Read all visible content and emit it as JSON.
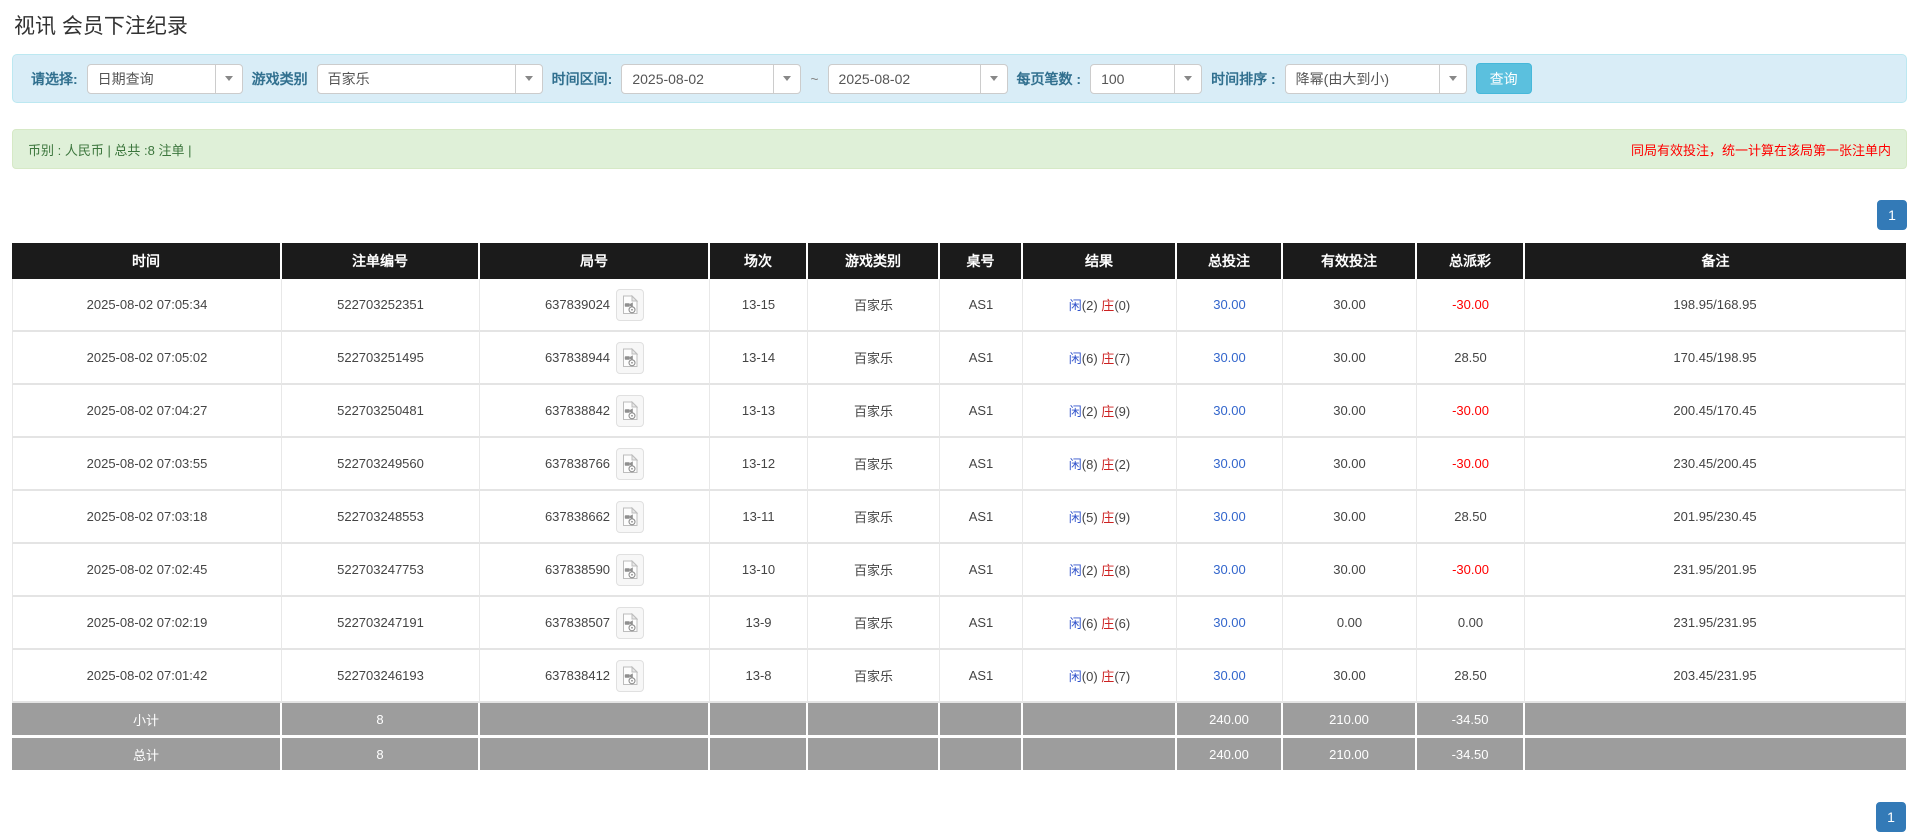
{
  "page": {
    "title": "视讯 会员下注纪录"
  },
  "filters": {
    "select_label": "请选择:",
    "select_value": "日期查询",
    "game_label": "游戏类别",
    "game_value": "百家乐",
    "range_label": "时间区间:",
    "date_from": "2025-08-02",
    "range_separator": "~",
    "date_to": "2025-08-02",
    "page_size_label": "每页笔数 :",
    "page_size_value": "100",
    "sort_label": "时间排序 :",
    "sort_value": "降幂(由大到小)",
    "search_button": "查询"
  },
  "summary": {
    "left": "币别 : 人民币 | 总共 :8 注单 |",
    "right_note": "同局有效投注，统一计算在该局第一张注单内"
  },
  "pagination": {
    "page": "1"
  },
  "colors": {
    "player_blue": "#3355cc",
    "banker_red": "#cc2222",
    "bet_link_blue": "#3366cc",
    "negative_red": "#ff0000",
    "pagination_blue": "#337ab7",
    "search_button_blue": "#5bc0de",
    "header_black": "#1b1b1b",
    "summary_row_gray": "#9d9d9d"
  },
  "table": {
    "columns": [
      "时间",
      "注单编号",
      "局号",
      "场次",
      "游戏类别",
      "桌号",
      "结果",
      "总投注",
      "有效投注",
      "总派彩",
      "备注"
    ],
    "result_labels": {
      "player": "闲",
      "banker": "庄"
    },
    "round_icon": "video-file-icon",
    "rows": [
      {
        "time": "2025-08-02 07:05:34",
        "bet_id": "522703252351",
        "round_id": "637839024",
        "session": "13-15",
        "game": "百家乐",
        "table_no": "AS1",
        "result": {
          "player": "2",
          "banker": "0"
        },
        "total_bet": "30.00",
        "valid_bet": "30.00",
        "payout": "-30.00",
        "remark": "198.95/168.95"
      },
      {
        "time": "2025-08-02 07:05:02",
        "bet_id": "522703251495",
        "round_id": "637838944",
        "session": "13-14",
        "game": "百家乐",
        "table_no": "AS1",
        "result": {
          "player": "6",
          "banker": "7"
        },
        "total_bet": "30.00",
        "valid_bet": "30.00",
        "payout": "28.50",
        "remark": "170.45/198.95"
      },
      {
        "time": "2025-08-02 07:04:27",
        "bet_id": "522703250481",
        "round_id": "637838842",
        "session": "13-13",
        "game": "百家乐",
        "table_no": "AS1",
        "result": {
          "player": "2",
          "banker": "9"
        },
        "total_bet": "30.00",
        "valid_bet": "30.00",
        "payout": "-30.00",
        "remark": "200.45/170.45"
      },
      {
        "time": "2025-08-02 07:03:55",
        "bet_id": "522703249560",
        "round_id": "637838766",
        "session": "13-12",
        "game": "百家乐",
        "table_no": "AS1",
        "result": {
          "player": "8",
          "banker": "2"
        },
        "total_bet": "30.00",
        "valid_bet": "30.00",
        "payout": "-30.00",
        "remark": "230.45/200.45"
      },
      {
        "time": "2025-08-02 07:03:18",
        "bet_id": "522703248553",
        "round_id": "637838662",
        "session": "13-11",
        "game": "百家乐",
        "table_no": "AS1",
        "result": {
          "player": "5",
          "banker": "9"
        },
        "total_bet": "30.00",
        "valid_bet": "30.00",
        "payout": "28.50",
        "remark": "201.95/230.45"
      },
      {
        "time": "2025-08-02 07:02:45",
        "bet_id": "522703247753",
        "round_id": "637838590",
        "session": "13-10",
        "game": "百家乐",
        "table_no": "AS1",
        "result": {
          "player": "2",
          "banker": "8"
        },
        "total_bet": "30.00",
        "valid_bet": "30.00",
        "payout": "-30.00",
        "remark": "231.95/201.95"
      },
      {
        "time": "2025-08-02 07:02:19",
        "bet_id": "522703247191",
        "round_id": "637838507",
        "session": "13-9",
        "game": "百家乐",
        "table_no": "AS1",
        "result": {
          "player": "6",
          "banker": "6"
        },
        "total_bet": "30.00",
        "valid_bet": "0.00",
        "payout": "0.00",
        "remark": "231.95/231.95"
      },
      {
        "time": "2025-08-02 07:01:42",
        "bet_id": "522703246193",
        "round_id": "637838412",
        "session": "13-8",
        "game": "百家乐",
        "table_no": "AS1",
        "result": {
          "player": "0",
          "banker": "7"
        },
        "total_bet": "30.00",
        "valid_bet": "30.00",
        "payout": "28.50",
        "remark": "203.45/231.95"
      }
    ],
    "summary_rows": [
      {
        "label": "小计",
        "count": "8",
        "total_bet": "240.00",
        "valid_bet": "210.00",
        "payout": "-34.50"
      },
      {
        "label": "总计",
        "count": "8",
        "total_bet": "240.00",
        "valid_bet": "210.00",
        "payout": "-34.50"
      }
    ]
  }
}
